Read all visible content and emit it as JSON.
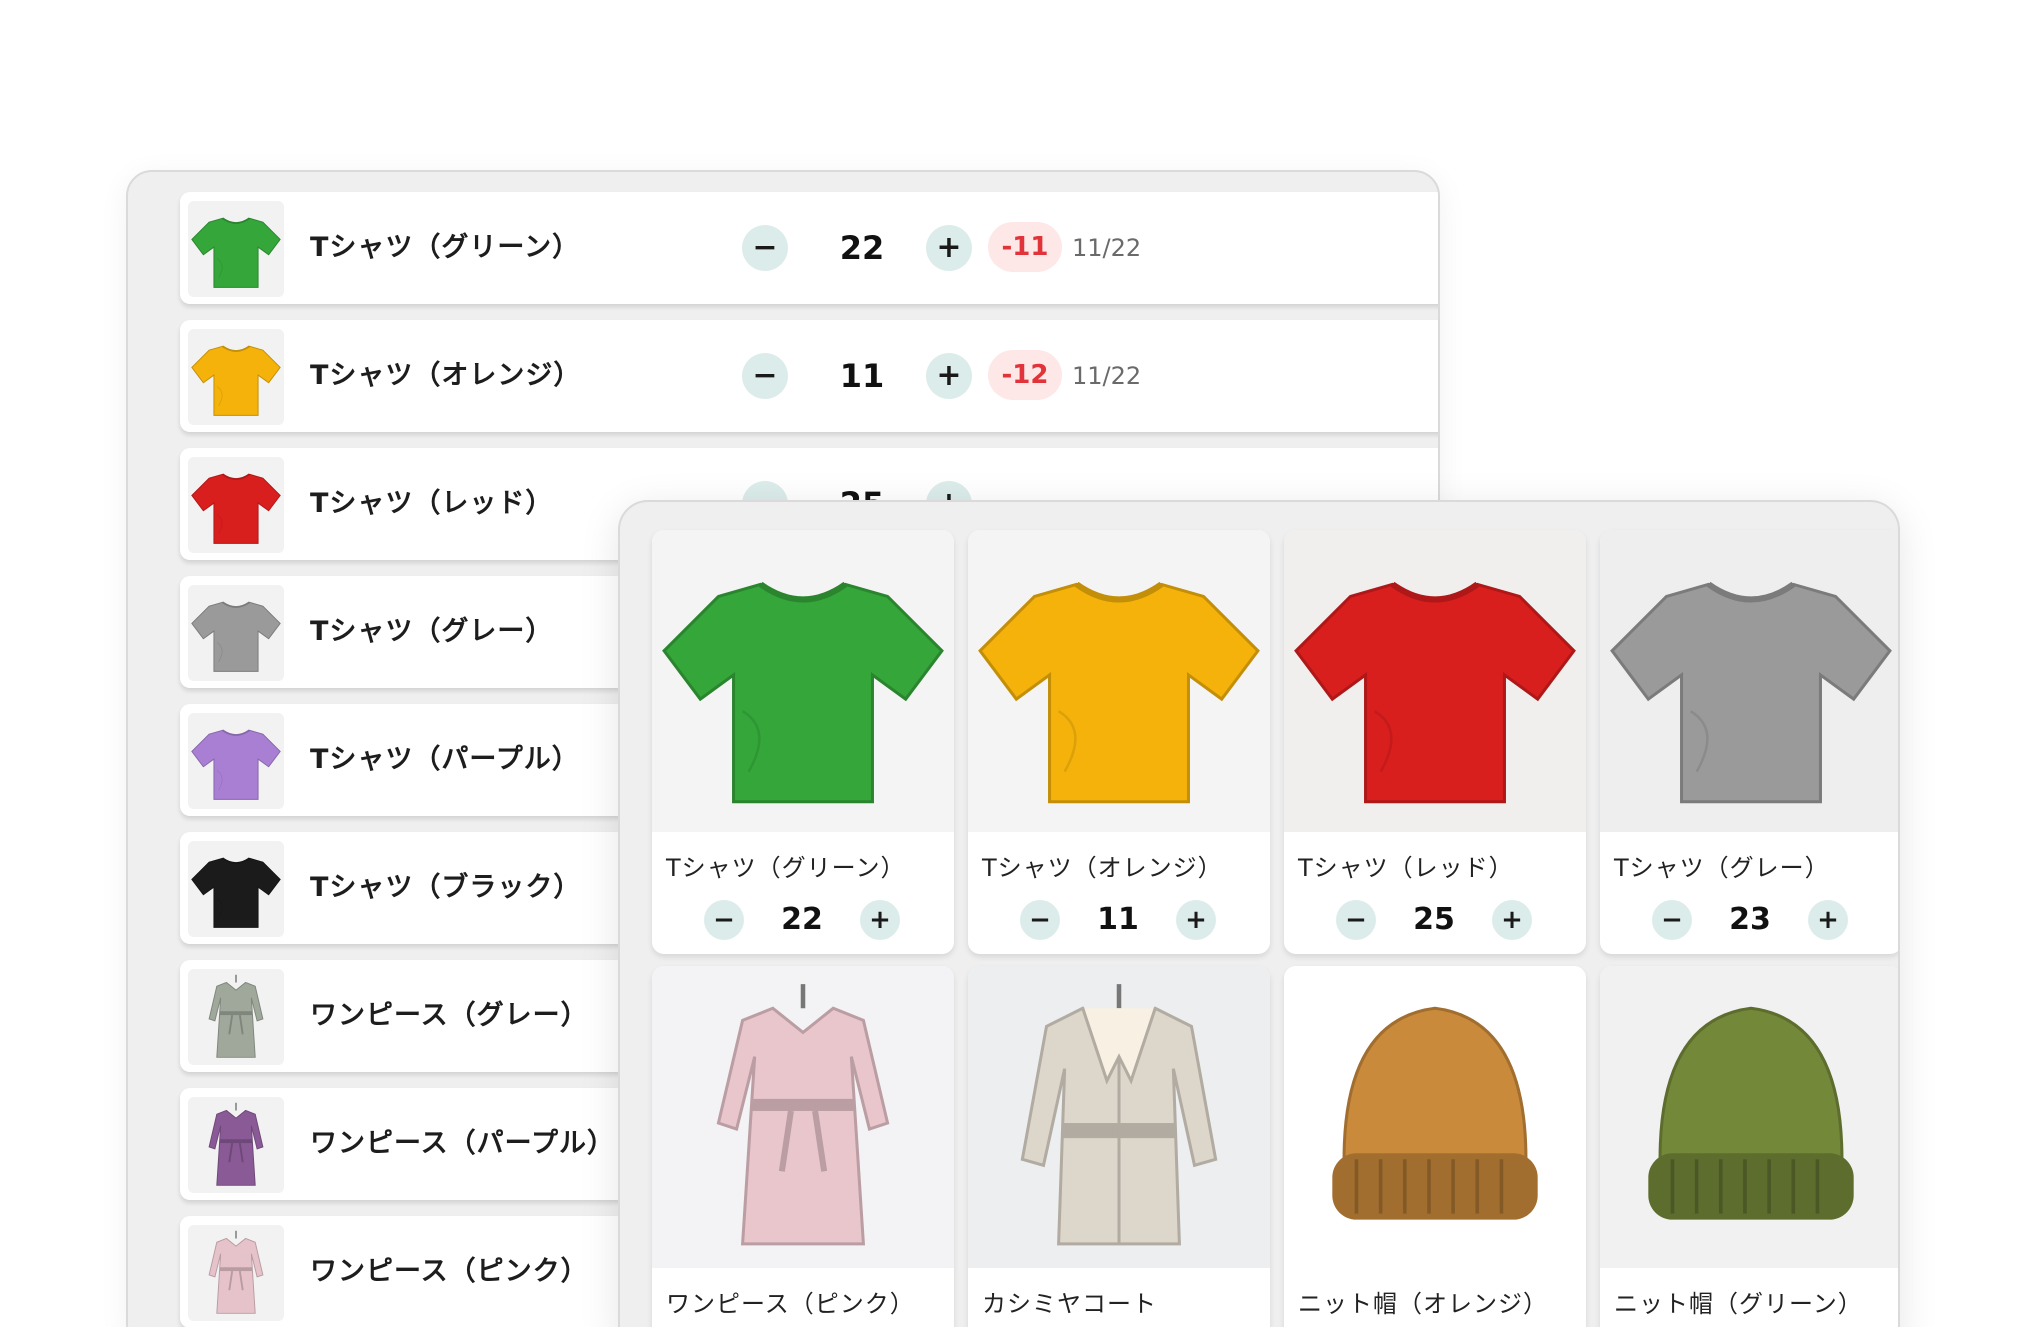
{
  "list_view": {
    "rows": [
      {
        "name": "Tシャツ（グリーン）",
        "qty": "22",
        "diff": "-11",
        "date": "11/22",
        "color": "#35a63a",
        "kind": "tshirt"
      },
      {
        "name": "Tシャツ（オレンジ）",
        "qty": "11",
        "diff": "-12",
        "date": "11/22",
        "color": "#f4b20a",
        "kind": "tshirt"
      },
      {
        "name": "Tシャツ（レッド）",
        "qty": "25",
        "diff": "",
        "date": "",
        "color": "#d91e1e",
        "kind": "tshirt"
      },
      {
        "name": "Tシャツ（グレー）",
        "qty": "",
        "diff": "",
        "date": "",
        "color": "#9a9a9a",
        "kind": "tshirt"
      },
      {
        "name": "Tシャツ（パープル）",
        "qty": "",
        "diff": "",
        "date": "",
        "color": "#a97fd4",
        "kind": "tshirt"
      },
      {
        "name": "Tシャツ（ブラック）",
        "qty": "",
        "diff": "",
        "date": "",
        "color": "#1b1b1b",
        "kind": "tshirt"
      },
      {
        "name": "ワンピース（グレー）",
        "qty": "",
        "diff": "",
        "date": "",
        "color": "#9fa89b",
        "kind": "dress"
      },
      {
        "name": "ワンピース（パープル）",
        "qty": "",
        "diff": "",
        "date": "",
        "color": "#8a5a96",
        "kind": "dress"
      },
      {
        "name": "ワンピース（ピンク）",
        "qty": "",
        "diff": "",
        "date": "",
        "color": "#e6c3cb",
        "kind": "dress"
      }
    ]
  },
  "grid_view": {
    "cards": [
      {
        "name": "Tシャツ（グリーン）",
        "qty": "22",
        "color": "#35a63a",
        "kind": "tshirt"
      },
      {
        "name": "Tシャツ（オレンジ）",
        "qty": "11",
        "color": "#f4b20a",
        "kind": "tshirt"
      },
      {
        "name": "Tシャツ（レッド）",
        "qty": "25",
        "color": "#d91e1e",
        "kind": "tshirt"
      },
      {
        "name": "Tシャツ（グレー）",
        "qty": "23",
        "color": "#9a9a9a",
        "kind": "tshirt"
      },
      {
        "name": "ワンピース（ピンク）",
        "qty": "",
        "color": "#e9c6cc",
        "kind": "dress"
      },
      {
        "name": "カシミヤコート",
        "qty": "",
        "color": "#ddd6cb",
        "kind": "coat"
      },
      {
        "name": "ニット帽（オレンジ）",
        "qty": "",
        "color": "#c98a3b",
        "kind": "beanie"
      },
      {
        "name": "ニット帽（グリーン）",
        "qty": "",
        "color": "#74883a",
        "kind": "beanie"
      }
    ]
  },
  "controls": {
    "minus_label": "−",
    "plus_label": "+"
  },
  "icons": {
    "minus": "minus-icon",
    "plus": "plus-icon"
  },
  "colors": {
    "button_bg": "#dcecea",
    "diff_bg": "#fde7e7",
    "diff_text": "#e0343a"
  }
}
